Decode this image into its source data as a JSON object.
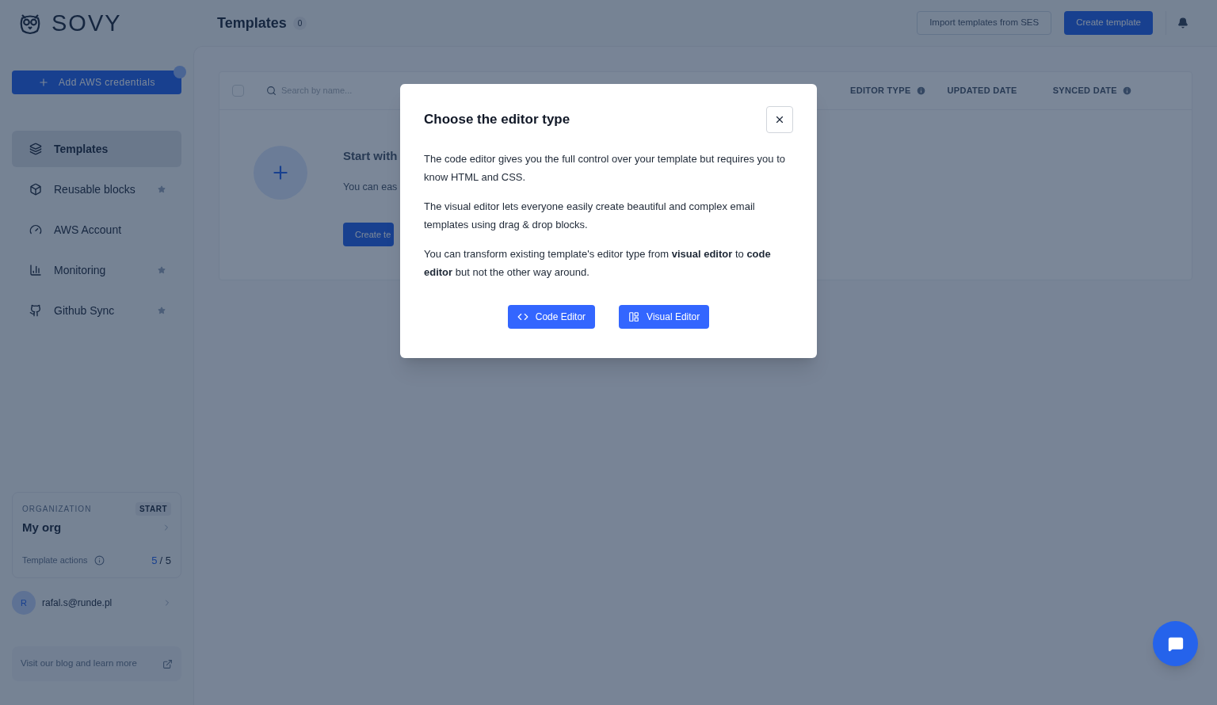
{
  "brand": {
    "name": "SOVY"
  },
  "header": {
    "title": "Templates",
    "count": "0",
    "buttons": [
      {
        "label": "Import templates from SES",
        "kind": "outline"
      },
      {
        "label": "Create template",
        "kind": "primary"
      }
    ]
  },
  "sidebar": {
    "add_button": {
      "label": "Add AWS credentials",
      "notification": true
    },
    "items": [
      {
        "label": "Templates",
        "selected": true,
        "starred": false
      },
      {
        "label": "Reusable blocks",
        "selected": false,
        "starred": true
      },
      {
        "label": "AWS Account",
        "selected": false,
        "starred": false
      },
      {
        "label": "Monitoring",
        "selected": false,
        "starred": true
      },
      {
        "label": "Github Sync",
        "selected": false,
        "starred": true
      }
    ],
    "organization": {
      "label": "ORGANIZATION",
      "plan": "START",
      "name": "My org",
      "usage_label": "Template actions",
      "used": "5",
      "total": "/ 5"
    },
    "user": {
      "initial": "R",
      "email": "rafal.s@runde.pl"
    },
    "blog_link": "Visit our blog and learn more"
  },
  "table": {
    "select_all": {
      "checked": false
    },
    "search": {
      "placeholder": "Search by name..."
    },
    "columns": [
      {
        "label": "EDITOR TYPE",
        "info": true
      },
      {
        "label": "UPDATED DATE",
        "info": false
      },
      {
        "label": "SYNCED DATE",
        "info": true
      }
    ],
    "empty_state": {
      "title": "Start with",
      "text": "You can eas",
      "button": "Create te"
    }
  },
  "modal": {
    "title": "Choose the editor type",
    "paragraphs": [
      "The code editor gives you the full control over your template but requires you to know HTML and CSS.",
      "The visual editor lets everyone easily create beautiful and complex email templates using drag & drop blocks.",
      "You can transform existing template's editor type from **visual editor** to **code editor** but not the other way around."
    ],
    "buttons": [
      {
        "label": "Code Editor"
      },
      {
        "label": "Visual Editor"
      }
    ]
  }
}
